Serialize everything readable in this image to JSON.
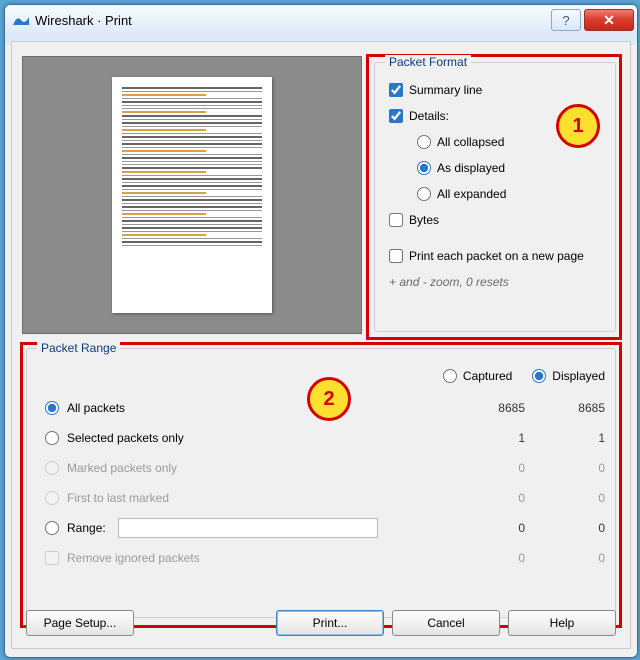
{
  "window": {
    "title": "Wireshark · Print"
  },
  "format": {
    "legend": "Packet Format",
    "summary_line": "Summary line",
    "details_label": "Details:",
    "all_collapsed": "All collapsed",
    "as_displayed": "As displayed",
    "all_expanded": "All expanded",
    "bytes": "Bytes",
    "each_new_page": "Print each packet on a new page",
    "zoom_hint": "+ and - zoom, 0 resets"
  },
  "range": {
    "legend": "Packet Range",
    "captured": "Captured",
    "displayed": "Displayed",
    "rows": {
      "all": {
        "label": "All packets",
        "captured": "8685",
        "displayed": "8685"
      },
      "selected": {
        "label": "Selected packets only",
        "captured": "1",
        "displayed": "1"
      },
      "marked": {
        "label": "Marked packets only",
        "captured": "0",
        "displayed": "0"
      },
      "ftl": {
        "label": "First to last marked",
        "captured": "0",
        "displayed": "0"
      },
      "rangeopt": {
        "label": "Range:",
        "captured": "0",
        "displayed": "0"
      },
      "ignore": {
        "label": "Remove ignored packets",
        "captured": "0",
        "displayed": "0"
      }
    },
    "range_value": ""
  },
  "buttons": {
    "page_setup": "Page Setup...",
    "print": "Print...",
    "cancel": "Cancel",
    "help": "Help"
  }
}
